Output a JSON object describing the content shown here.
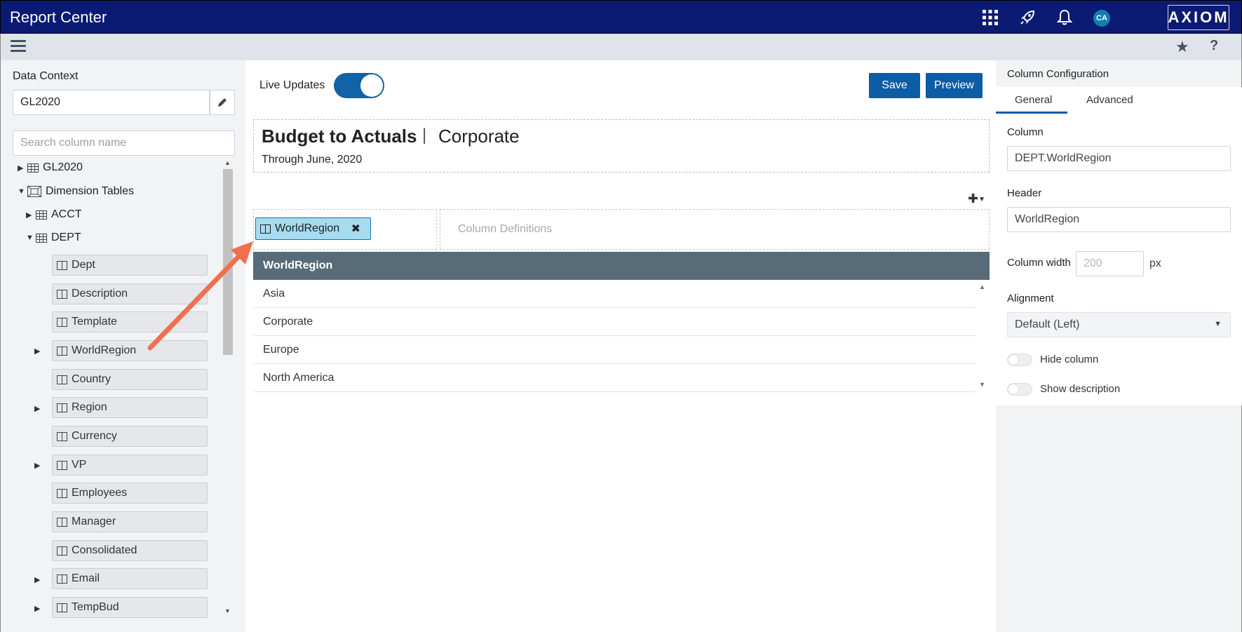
{
  "app": {
    "title": "Report Center",
    "logo_text": "AXIOM",
    "avatar_initials": "CA"
  },
  "topbar_icons": [
    "apps-grid-icon",
    "rocket-icon",
    "bell-icon"
  ],
  "subbar_icons": [
    "menu-icon",
    "star-icon",
    "help-icon"
  ],
  "left_panel": {
    "data_context_label": "Data Context",
    "data_context_value": "GL2020",
    "search_placeholder": "Search column name",
    "tree": [
      {
        "label": "GL2020",
        "expanded": false,
        "level": 0
      },
      {
        "label": "Dimension Tables",
        "expanded": true,
        "level": 0
      },
      {
        "label": "ACCT",
        "expanded": false,
        "level": 1
      },
      {
        "label": "DEPT",
        "expanded": true,
        "level": 1
      }
    ],
    "fields": [
      {
        "label": "Dept",
        "expandable": false
      },
      {
        "label": "Description",
        "expandable": false
      },
      {
        "label": "Template",
        "expandable": false
      },
      {
        "label": "WorldRegion",
        "expandable": true
      },
      {
        "label": "Country",
        "expandable": false
      },
      {
        "label": "Region",
        "expandable": true
      },
      {
        "label": "Currency",
        "expandable": false
      },
      {
        "label": "VP",
        "expandable": true
      },
      {
        "label": "Employees",
        "expandable": false
      },
      {
        "label": "Manager",
        "expandable": false
      },
      {
        "label": "Consolidated",
        "expandable": false
      },
      {
        "label": "Email",
        "expandable": true
      },
      {
        "label": "TempBud",
        "expandable": true
      }
    ]
  },
  "center": {
    "live_updates_label": "Live Updates",
    "live_updates_on": true,
    "save_label": "Save",
    "preview_label": "Preview",
    "report_title": "Budget to Actuals",
    "report_separator": "|",
    "report_subtitle": "Corporate",
    "report_date": "Through June, 2020",
    "row_chip_label": "WorldRegion",
    "column_definitions_placeholder": "Column Definitions",
    "grid_header": "WorldRegion",
    "grid_rows": [
      "Asia",
      "Corporate",
      "Europe",
      "North America"
    ]
  },
  "right_panel": {
    "title": "Column Configuration",
    "tabs": [
      "General",
      "Advanced"
    ],
    "active_tab": "General",
    "column_label": "Column",
    "column_value": "DEPT.WorldRegion",
    "header_label": "Header",
    "header_value": "WorldRegion",
    "width_label": "Column width",
    "width_placeholder": "200",
    "width_unit": "px",
    "alignment_label": "Alignment",
    "alignment_value": "Default (Left)",
    "hide_column_label": "Hide column",
    "show_description_label": "Show description"
  },
  "colors": {
    "topbar": "#0b1a72",
    "accent": "#0c5da5",
    "grid_header": "#576b78",
    "chip": "#a6dcf0",
    "annotation_arrow": "#f07050"
  }
}
